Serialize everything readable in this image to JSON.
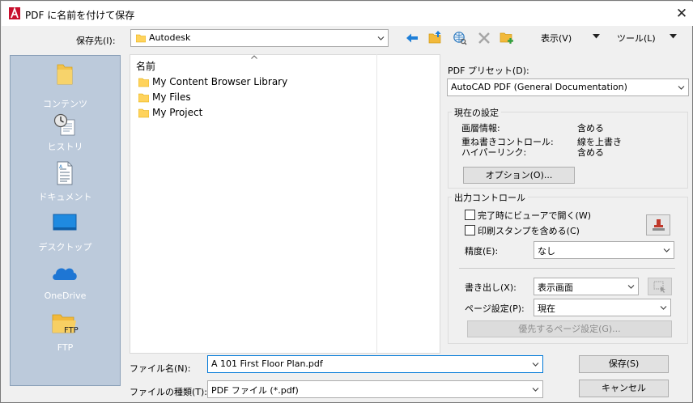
{
  "window": {
    "title": "PDF に名前を付けて保存",
    "close_label": "✕"
  },
  "location": {
    "label": "保存先(I):",
    "value": "Autodesk"
  },
  "toolbar": {
    "back_icon": "back-arrow-icon",
    "up_icon": "up-folder-icon",
    "web_icon": "web-search-icon",
    "delete_icon": "delete-icon",
    "newfolder_icon": "new-folder-icon",
    "view_label": "表示(V)",
    "tools_label": "ツール(L)"
  },
  "places": [
    {
      "label": "コンテンツ",
      "icon": "folder-icon"
    },
    {
      "label": "ヒストリ",
      "icon": "history-icon"
    },
    {
      "label": "ドキュメント",
      "icon": "document-icon"
    },
    {
      "label": "デスクトップ",
      "icon": "desktop-icon"
    },
    {
      "label": "OneDrive",
      "icon": "onedrive-icon"
    },
    {
      "label": "FTP",
      "icon": "ftp-folder-icon",
      "badge": "FTP"
    }
  ],
  "filelist": {
    "column_header": "名前",
    "items": [
      "My Content Browser Library",
      "My Files",
      "My Project"
    ]
  },
  "filename": {
    "label": "ファイル名(N):",
    "value": "A 101 First Floor Plan.pdf"
  },
  "filetype": {
    "label": "ファイルの種類(T):",
    "value": "PDF ファイル (*.pdf)"
  },
  "buttons": {
    "save": "保存(S)",
    "cancel": "キャンセル"
  },
  "pdf_preset": {
    "label": "PDF プリセット(D):",
    "value": "AutoCAD PDF (General Documentation)"
  },
  "current_settings": {
    "title": "現在の設定",
    "rows": [
      {
        "name": "画層情報:",
        "value": "含める"
      },
      {
        "name": "重ね書きコントロール:",
        "value": "線を上書き"
      },
      {
        "name": "ハイパーリンク:",
        "value": "含める"
      }
    ],
    "options_button": "オプション(O)..."
  },
  "output_control": {
    "title": "出力コントロール",
    "open_viewer": "完了時にビューアで開く(W)",
    "include_stamp": "印刷スタンプを含める(C)",
    "precision_label": "精度(E):",
    "precision_value": "なし",
    "export_label": "書き出し(X):",
    "export_value": "表示画面",
    "page_setup_label": "ページ設定(P):",
    "page_setup_value": "現在",
    "page_setup_override": "優先するページ設定(G)..."
  }
}
